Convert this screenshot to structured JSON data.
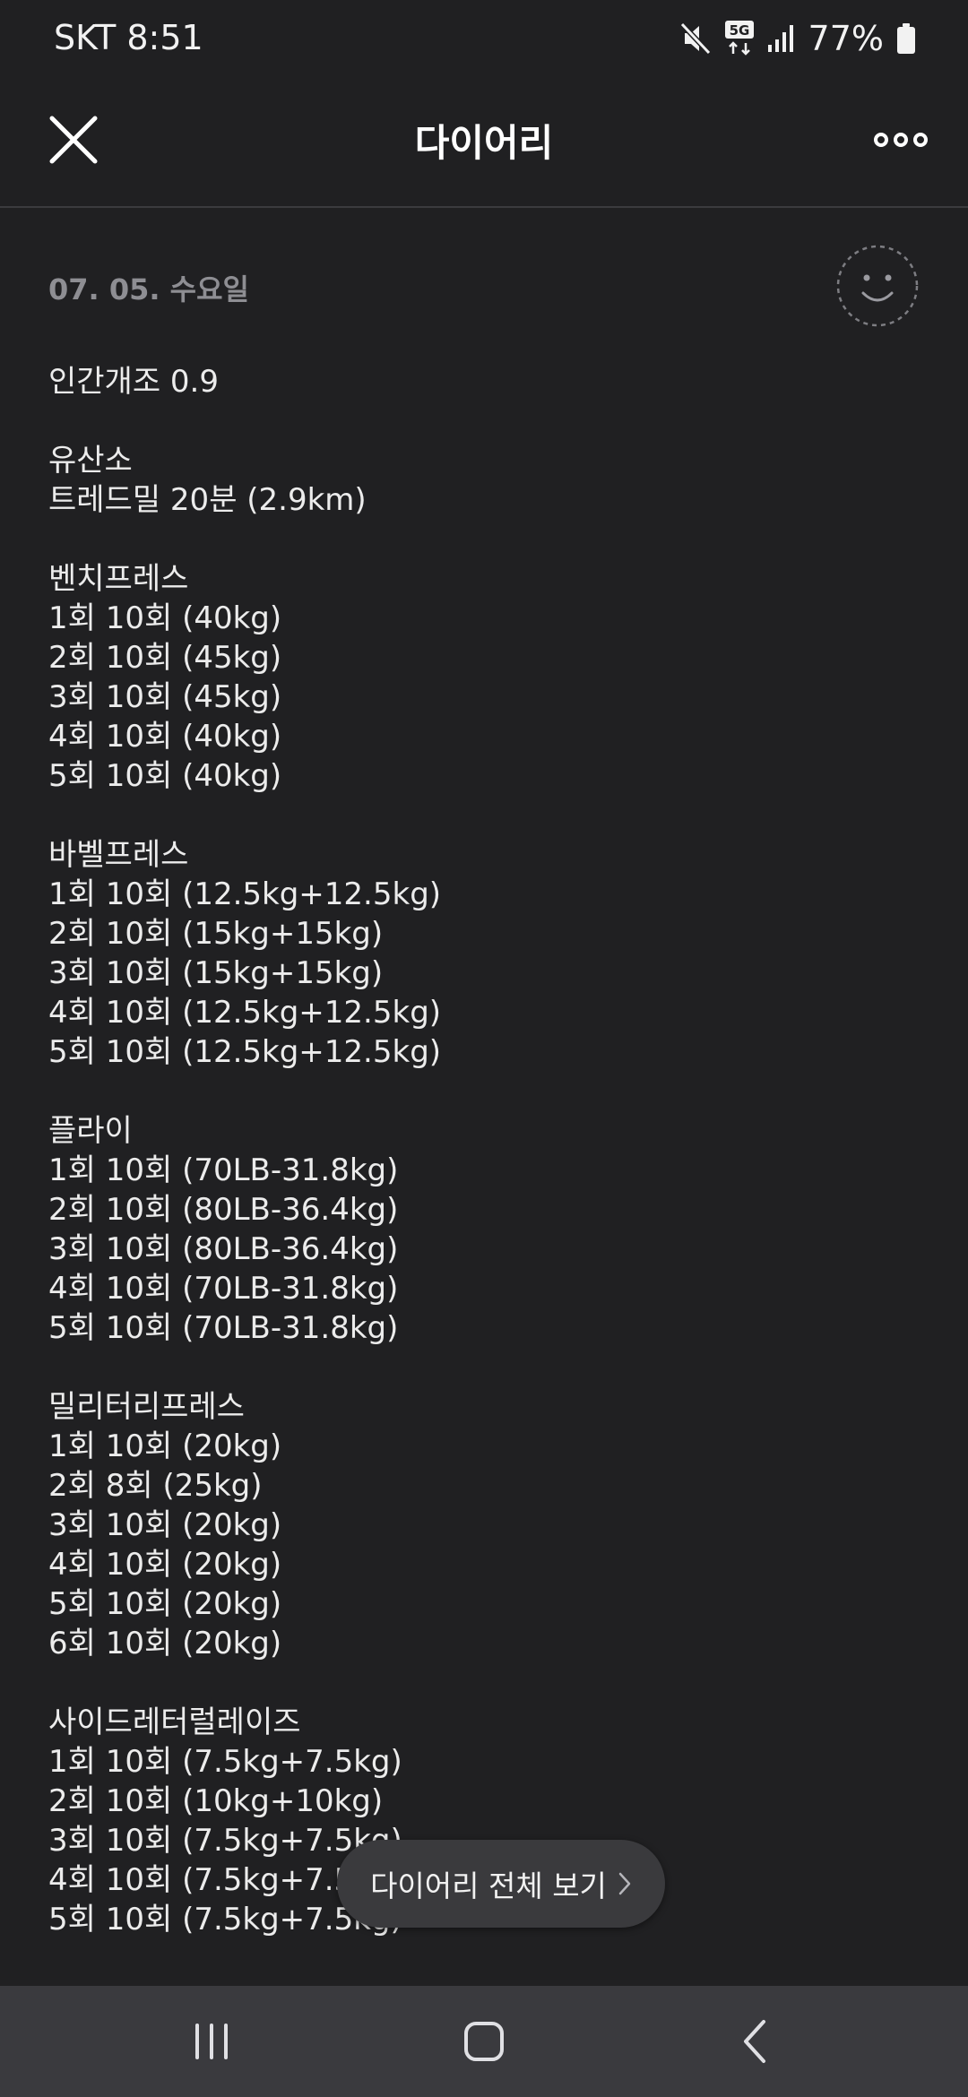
{
  "status_bar": {
    "carrier_time": "SKT 8:51",
    "network": "5G",
    "battery": "77%",
    "icons": [
      "mute-icon",
      "5g-icon",
      "signal-icon",
      "battery-icon"
    ]
  },
  "app_bar": {
    "title": "다이어리",
    "close_icon": "close-icon",
    "more_icon": "more-icon"
  },
  "entry": {
    "date": "07. 05. 수요일",
    "mood_icon": "smiley-icon",
    "lines": [
      "인간개조 0.9",
      "",
      "유산소",
      "트레드밀 20분 (2.9km)",
      "",
      "벤치프레스",
      "1회 10회 (40kg)",
      "2회 10회 (45kg)",
      "3회 10회 (45kg)",
      "4회 10회 (40kg)",
      "5회 10회 (40kg)",
      "",
      "바벨프레스",
      "1회 10회 (12.5kg+12.5kg)",
      "2회 10회 (15kg+15kg)",
      "3회 10회 (15kg+15kg)",
      "4회 10회 (12.5kg+12.5kg)",
      "5회 10회 (12.5kg+12.5kg)",
      "",
      "플라이",
      "1회 10회 (70LB-31.8kg)",
      "2회 10회 (80LB-36.4kg)",
      "3회 10회 (80LB-36.4kg)",
      "4회 10회 (70LB-31.8kg)",
      "5회 10회 (70LB-31.8kg)",
      "",
      "밀리터리프레스",
      "1회 10회 (20kg)",
      "2회 8회 (25kg)",
      "3회 10회 (20kg)",
      "4회 10회 (20kg)",
      "5회 10회 (20kg)",
      "6회 10회 (20kg)",
      "",
      "사이드레터럴레이즈",
      "1회 10회 (7.5kg+7.5kg)",
      "2회 10회 (10kg+10kg)",
      "3회 10회 (7.5kg+7.5kg)",
      "4회 10회 (7.5kg+7.5kg)",
      "5회 10회 (7.5kg+7.5kg)"
    ]
  },
  "floating_button": {
    "label": "다이어리 전체 보기",
    "icon": "chevron-right-icon"
  },
  "nav_bar": {
    "icons": [
      "recents-icon",
      "home-icon",
      "back-icon"
    ]
  },
  "colors": {
    "background": "#202022",
    "text": "#ececec",
    "muted": "#8e8e93",
    "pill": "#3a3a3d",
    "nav": "#3a3a3e"
  }
}
